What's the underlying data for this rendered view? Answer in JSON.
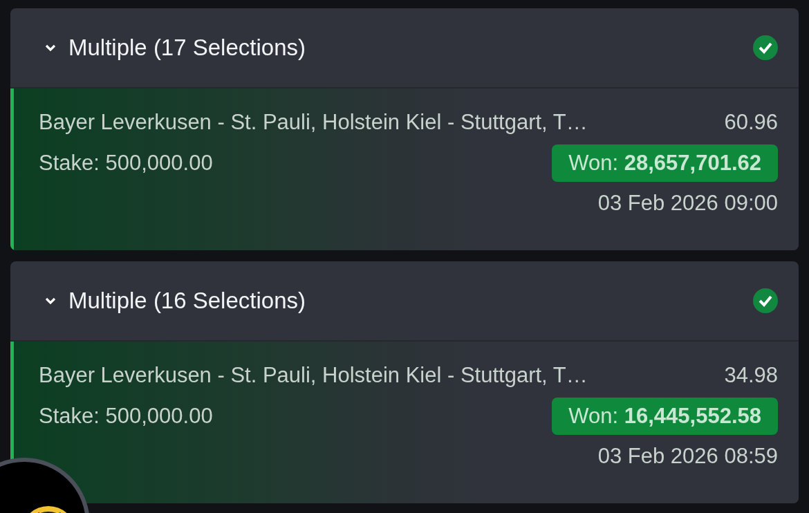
{
  "bets": [
    {
      "title": "Multiple (17 Selections)",
      "expanded": true,
      "won": true,
      "selections": "Bayer Leverkusen - St. Pauli, Holstein Kiel - Stuttgart, T…",
      "odds": "60.96",
      "stake": "Stake: 500,000.00",
      "result": "Won: **28,657,701.62**",
      "date": "03 Feb 2026 09:00"
    },
    {
      "title": "Multiple (16 Selections)",
      "expanded": true,
      "won": true,
      "selections": "Bayer Leverkusen - St. Pauli, Holstein Kiel - Stuttgart, T…",
      "odds": "34.98",
      "stake": "Stake: 500,000.00",
      "result": "Won: **16,445,552.58**",
      "date": "03 Feb 2026 08:59"
    }
  ]
}
